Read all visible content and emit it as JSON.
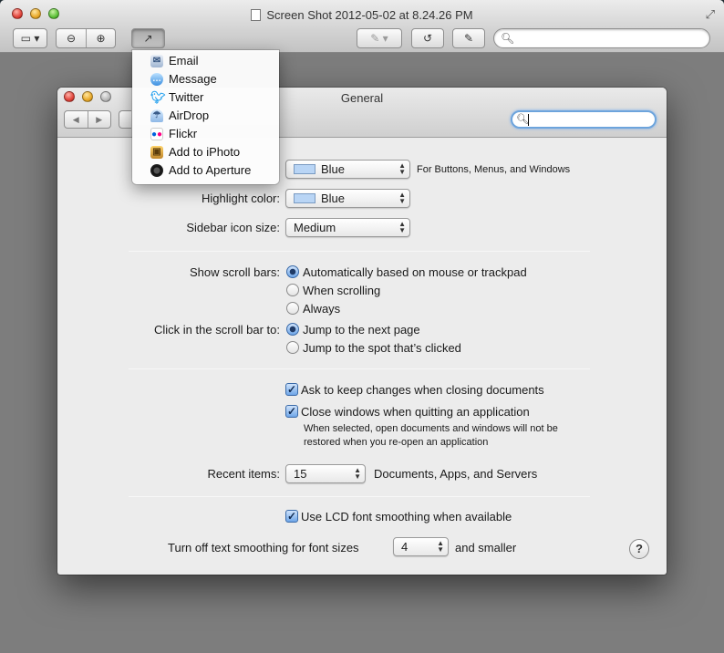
{
  "outer_window": {
    "title": "Screen Shot 2012-05-02 at 8.24.26 PM",
    "icons": [
      "sidebar-icon",
      "zoom-out-icon",
      "zoom-in-icon",
      "share-icon",
      "annotate-icon",
      "rotate-icon",
      "edit-icon",
      "search-icon",
      "fullscreen-icon"
    ]
  },
  "share_menu": {
    "items": [
      {
        "label": "Email",
        "icon": "email-icon"
      },
      {
        "label": "Message",
        "icon": "message-icon"
      },
      {
        "label": "Twitter",
        "icon": "twitter-icon"
      },
      {
        "label": "AirDrop",
        "icon": "airdrop-icon"
      },
      {
        "label": "Flickr",
        "icon": "flickr-icon"
      },
      {
        "label": "Add to iPhoto",
        "icon": "iphoto-icon"
      },
      {
        "label": "Add to Aperture",
        "icon": "aperture-icon"
      }
    ]
  },
  "prefs": {
    "title": "General",
    "appearance": {
      "value": "Blue",
      "note": "For Buttons, Menus, and Windows"
    },
    "highlight": {
      "label": "Highlight color:",
      "value": "Blue"
    },
    "sidebar_icon_size": {
      "label": "Sidebar icon size:",
      "value": "Medium"
    },
    "scroll_bars": {
      "label": "Show scroll bars:",
      "options": [
        "Automatically based on mouse or trackpad",
        "When scrolling",
        "Always"
      ],
      "selected": 0
    },
    "scroll_click": {
      "label": "Click in the scroll bar to:",
      "options": [
        "Jump to the next page",
        "Jump to the spot that’s clicked"
      ],
      "selected": 0
    },
    "ask_keep_changes": {
      "label": "Ask to keep changes when closing documents",
      "checked": true
    },
    "close_windows": {
      "label": "Close windows when quitting an application",
      "checked": true,
      "note_line1": "When selected, open documents and windows will not be",
      "note_line2": "restored when you re-open an application"
    },
    "recent_items": {
      "label": "Recent items:",
      "value": "15",
      "suffix": "Documents, Apps, and Servers"
    },
    "lcd_smoothing": {
      "label": "Use LCD font smoothing when available",
      "checked": true
    },
    "text_smoothing": {
      "label": "Turn off text smoothing for font sizes",
      "value": "4",
      "suffix": "and smaller"
    },
    "help": "?"
  },
  "colors": {
    "accent": "#6fa6e8",
    "swatch": "#b9d5f5",
    "window": "#ececec",
    "desktop": "#7d7d7d"
  }
}
